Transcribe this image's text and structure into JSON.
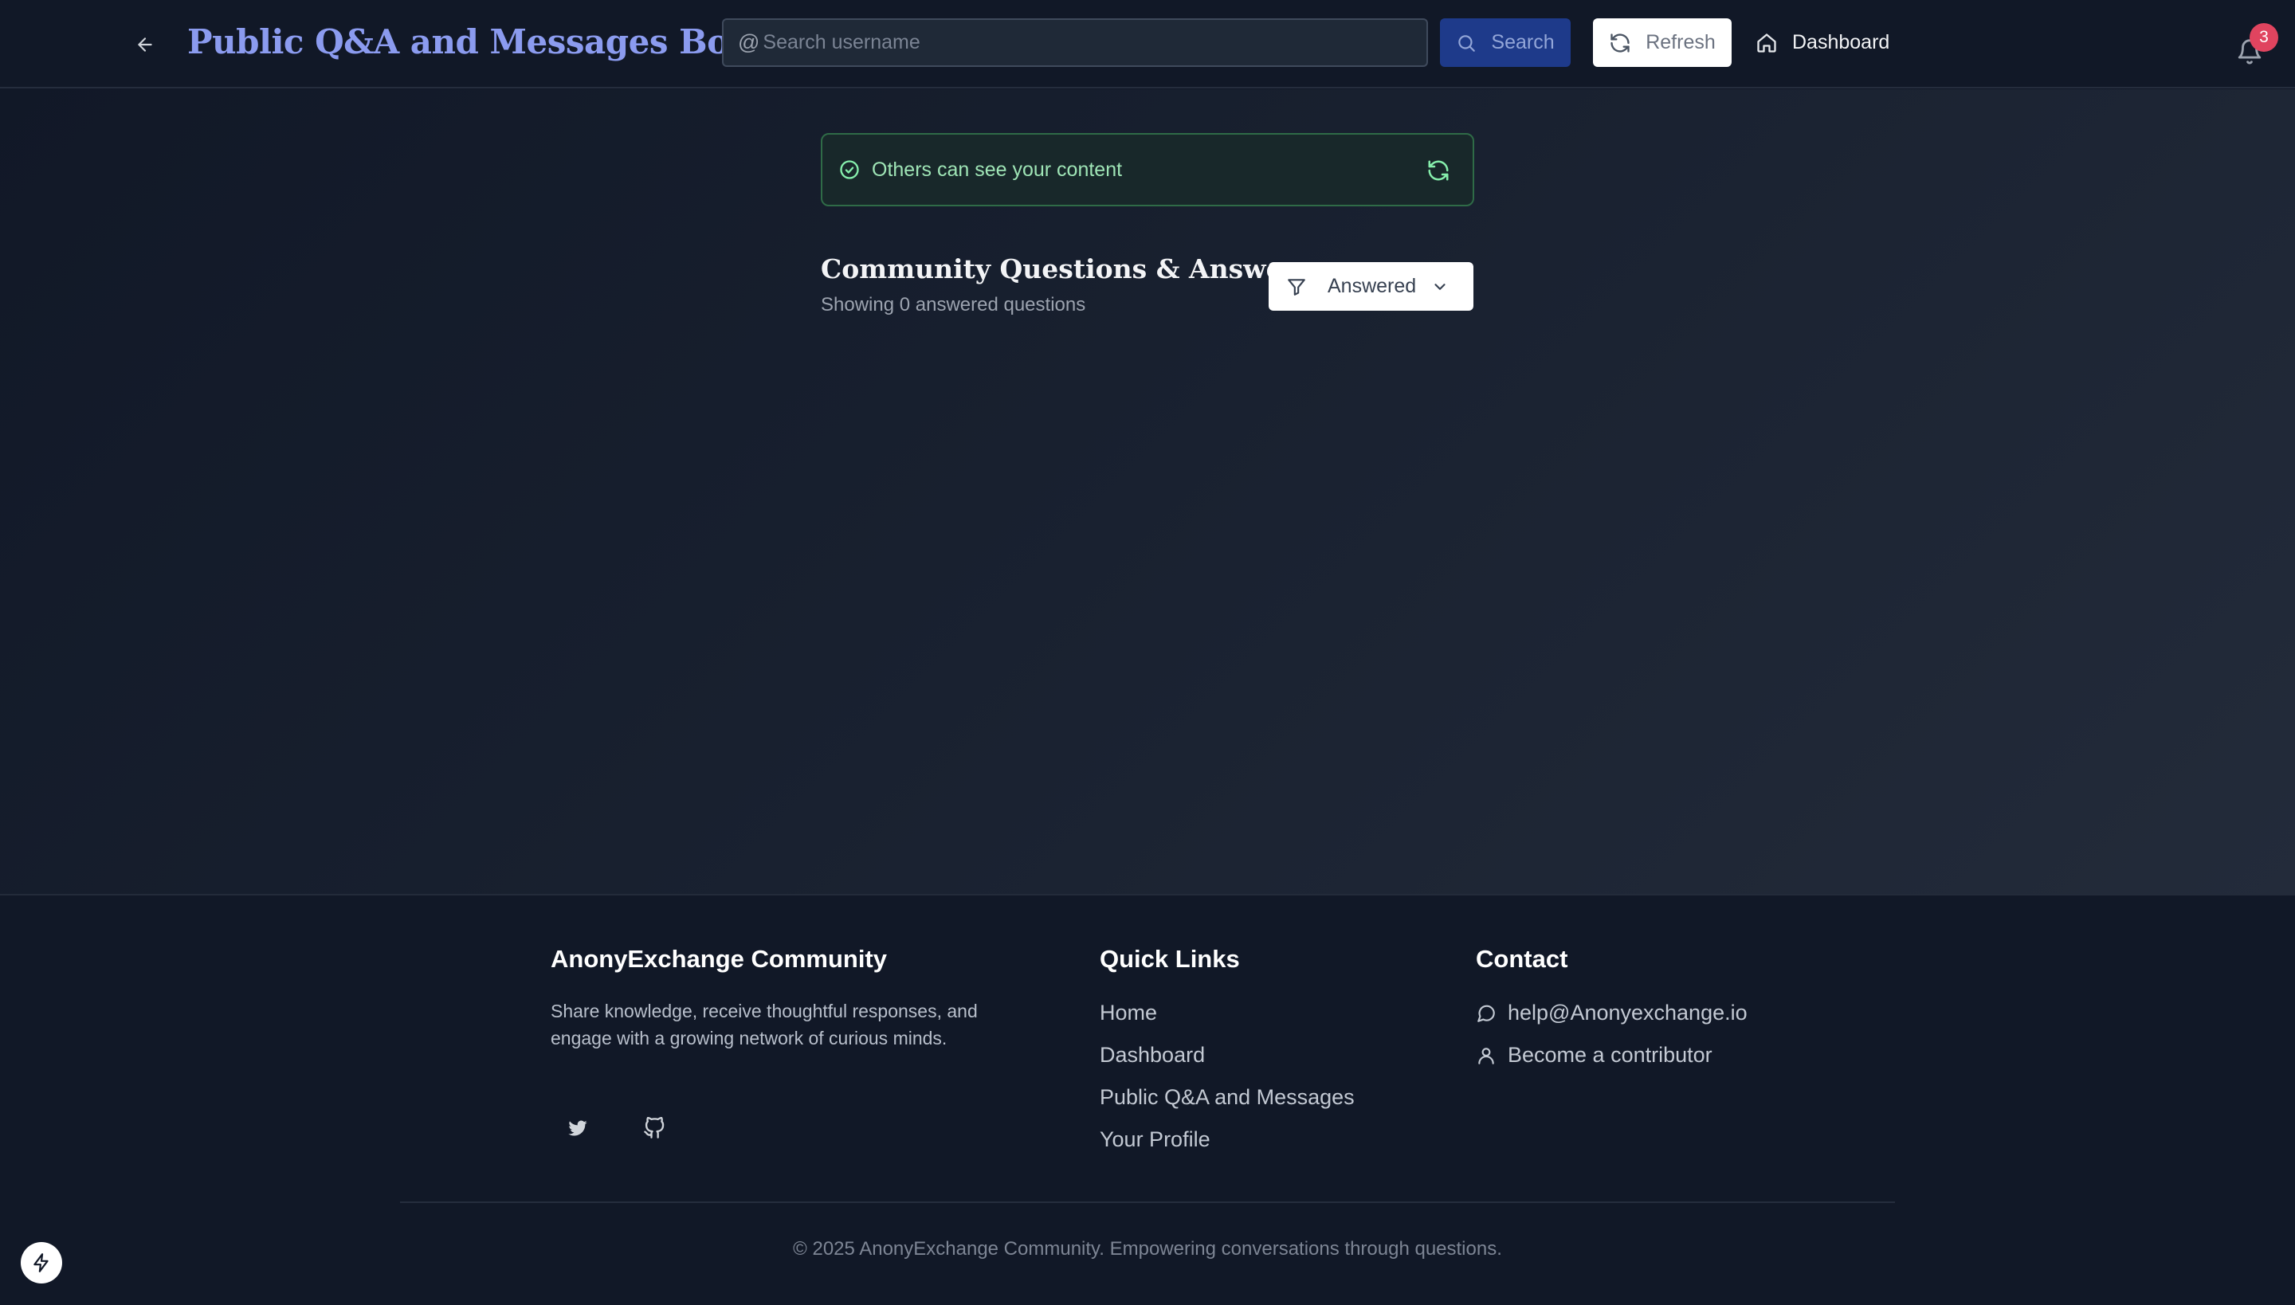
{
  "header": {
    "title": "Public Q&A and Messages Board",
    "search_prefix": "@",
    "search_placeholder": "Search username",
    "search_value": "",
    "search_button": "Search",
    "refresh_button": "Refresh",
    "dashboard_link": "Dashboard",
    "notification_count": "3"
  },
  "main": {
    "visibility_status": "Others can see your content",
    "section_title": "Community Questions & Answers",
    "section_subtitle": "Showing 0 answered questions",
    "filter_selected": "Answered"
  },
  "footer": {
    "brand_title": "AnonyExchange Community",
    "brand_description": "Share knowledge, receive thoughtful responses, and engage with a growing network of curious minds.",
    "quick_links_title": "Quick Links",
    "quick_links": [
      "Home",
      "Dashboard",
      "Public Q&A and Messages",
      "Your Profile"
    ],
    "contact_title": "Contact",
    "contact_email": "help@Anonyexchange.io",
    "contact_contribute": "Become a contributor",
    "copyright": "© 2025 AnonyExchange Community. Empowering conversations through questions."
  },
  "colors": {
    "background": "#111827",
    "title_accent": "#8b9bef",
    "search_button_bg": "#1e3a8a",
    "badge": "#e0445f",
    "success_text": "#9fe5b6",
    "success_border": "#2f6b47"
  },
  "icons": {
    "back": "arrow-left-icon",
    "search": "search-icon",
    "refresh": "refresh-icon",
    "dashboard": "home-icon",
    "notifications": "bell-icon",
    "status": "check-circle-icon",
    "filter": "filter-icon",
    "dropdown": "chevron-down-icon",
    "twitter": "twitter-icon",
    "github": "github-icon",
    "email": "message-circle-icon",
    "contributor": "user-icon",
    "bolt": "bolt-icon"
  }
}
